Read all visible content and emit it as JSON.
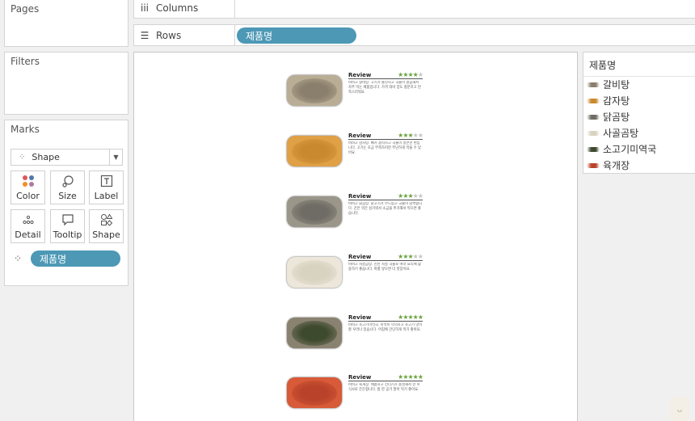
{
  "sidebar": {
    "pages_title": "Pages",
    "filters_title": "Filters",
    "marks_title": "Marks",
    "mark_type": "Shape",
    "mark_buttons": [
      {
        "label": "Color",
        "icon": "color-dots-icon"
      },
      {
        "label": "Size",
        "icon": "size-icon"
      },
      {
        "label": "Label",
        "icon": "label-icon"
      },
      {
        "label": "Detail",
        "icon": "detail-icon"
      },
      {
        "label": "Tooltip",
        "icon": "tooltip-icon"
      },
      {
        "label": "Shape",
        "icon": "shape-icon"
      }
    ],
    "marks_field": "제품명"
  },
  "shelves": {
    "columns_label": "Columns",
    "rows_label": "Rows",
    "rows_pill": "제품명"
  },
  "view": {
    "rows": [
      {
        "title": "Review",
        "rating": 4,
        "text": "비비고 갈비탕. 고기가 쫄깃하고 국물이 깔끔해서 자주 먹는 제품입니다. 가격 대비 양도 충분하고 만족스러워요.",
        "food_color": "#8a7f6c",
        "broth_color": "#b9ae95"
      },
      {
        "title": "Review",
        "rating": 3,
        "text": "비비고 감자탕. 뼈가 큼직하고 국물이 얼큰한 편입니다. 고기는 조금 부족하지만 무난하게 먹을 수 있어요.",
        "food_color": "#c9892e",
        "broth_color": "#e0a046"
      },
      {
        "title": "Review",
        "rating": 3,
        "text": "비비고 닭곰탕. 닭고기가 부드럽고 국물이 담백합니다. 간은 약간 싱거워서 소금을 추가해서 먹으면 좋습니다.",
        "food_color": "#6e6c64",
        "broth_color": "#9a968a"
      },
      {
        "title": "Review",
        "rating": 3,
        "text": "비비고 사골곰탕. 진한 사골 국물로 여러 요리에 활용하기 좋습니다. 파를 넣으면 더 맛있어요.",
        "food_color": "#d8d2c0",
        "broth_color": "#ece7da"
      },
      {
        "title": "Review",
        "rating": 5,
        "text": "비비고 소고기미역국. 미역이 넉넉하고 소고기 맛이 잘 우러나 있습니다. 아침에 간단하게 먹기 좋아요.",
        "food_color": "#3e4a2e",
        "broth_color": "#8a8270"
      },
      {
        "title": "Review",
        "rating": 5,
        "text": "비비고 육개장. 매콤하고 건더기가 풍성해서 한 끼 식사로 든든합니다. 밥 한 공기 말아 먹기 좋아요.",
        "food_color": "#b8432a",
        "broth_color": "#d85a38"
      }
    ],
    "max_rating": 5
  },
  "legend": {
    "title": "제품명",
    "items": [
      {
        "label": "갈비탕",
        "color": "#8a7f6c"
      },
      {
        "label": "감자탕",
        "color": "#c9892e"
      },
      {
        "label": "닭곰탕",
        "color": "#6e6c64"
      },
      {
        "label": "사골곰탕",
        "color": "#d8d2c0"
      },
      {
        "label": "소고기미역국",
        "color": "#3e4a2e"
      },
      {
        "label": "육개장",
        "color": "#b8432a"
      }
    ]
  },
  "colors": {
    "pill": "#4c98b5",
    "star_on": "#6aa23c",
    "star_off": "#c4c4c4"
  }
}
